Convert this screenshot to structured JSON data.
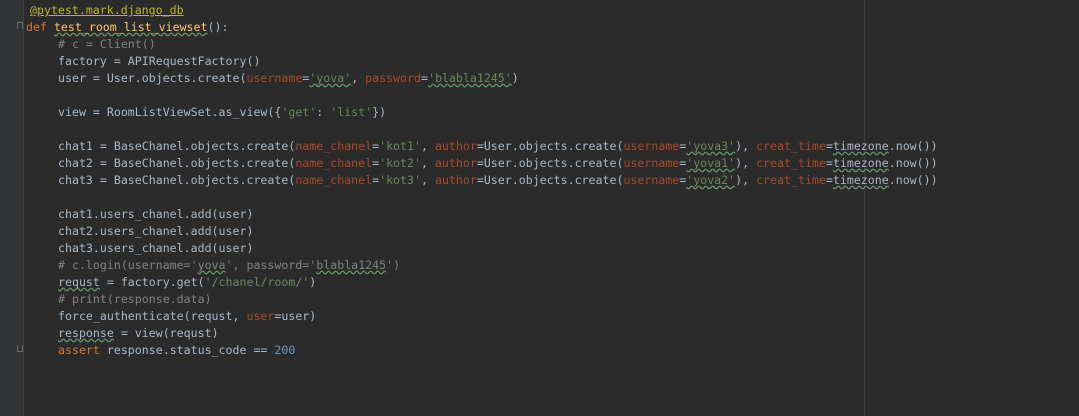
{
  "editor": {
    "language": "python",
    "colors": {
      "background": "#2b2b2b",
      "gutter": "#313335",
      "keyword": "#cc7832",
      "function": "#ffc66d",
      "string": "#6a8759",
      "parameter": "#aa4926",
      "number": "#6897bb",
      "comment": "#808080",
      "decorator": "#bbb529",
      "text": "#a9b7c6"
    },
    "lines": {
      "l1": {
        "decorator": "@pytest.mark.django_db"
      },
      "l2": {
        "def": "def",
        "name": "test_room_list_viewset",
        "tail": "():"
      },
      "l3": {
        "comment": "# c = Client()"
      },
      "l4": {
        "text": "factory = APIRequestFactory()"
      },
      "l5": {
        "a": "user = User.objects.create(",
        "p1": "username",
        "eq1": "=",
        "s1": "'yova'",
        "sep": ", ",
        "p2": "password",
        "eq2": "=",
        "s2": "'blabla1245'",
        "end": ")"
      },
      "l6": {
        "a": "view = RoomListViewSet.as_view({",
        "s1": "'get'",
        "mid": ": ",
        "s2": "'list'",
        "end": "})"
      },
      "chats": [
        {
          "a": "chat1 = BaseChanel.objects.create(",
          "p1": "name_chanel",
          "s1": "'kot1'",
          "p2": "author",
          "b": "User.objects.create(",
          "p3": "username",
          "s2": "'yova3'",
          "c": "), ",
          "p4": "creat_time",
          "d": "timezone",
          "e": ".now())"
        },
        {
          "a": "chat2 = BaseChanel.objects.create(",
          "p1": "name_chanel",
          "s1": "'kot2'",
          "p2": "author",
          "b": "User.objects.create(",
          "p3": "username",
          "s2": "'yova1'",
          "c": "), ",
          "p4": "creat_time",
          "d": "timezone",
          "e": ".now())"
        },
        {
          "a": "chat3 = BaseChanel.objects.create(",
          "p1": "name_chanel",
          "s1": "'kot3'",
          "p2": "author",
          "b": "User.objects.create(",
          "p3": "username",
          "s2": "'yova2'",
          "c": "), ",
          "p4": "creat_time",
          "d": "timezone",
          "e": ".now())"
        }
      ],
      "adds": [
        "chat1.users_chanel.add(user)",
        "chat2.users_chanel.add(user)",
        "chat3.users_chanel.add(user)"
      ],
      "l_login": {
        "a": "# c.login(username='",
        "typo1": "yova",
        "b": "', password='",
        "typo2": "blabla1245",
        "c": "')"
      },
      "l_requst": {
        "var": "requst",
        "a": " = factory.get(",
        "s": "'/chanel/room/'",
        "end": ")"
      },
      "l_print": {
        "comment": "# print(response.data)"
      },
      "l_force": {
        "a": "force_authenticate(requst, ",
        "p": "user",
        "b": "=user)"
      },
      "l_view": {
        "var": "response",
        "a": " = view(requst)"
      },
      "l_assert": {
        "kw": "assert",
        "a": " response.status_code == ",
        "num": "200"
      }
    }
  }
}
